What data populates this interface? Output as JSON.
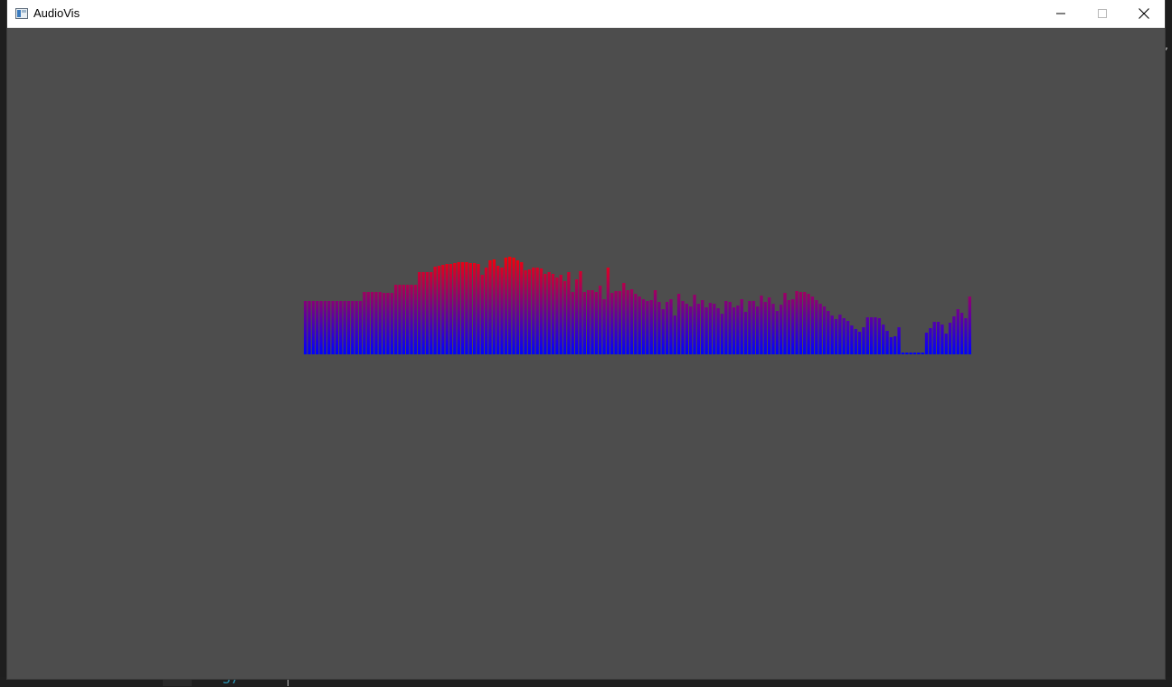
{
  "window": {
    "title": "AudioVis",
    "background_color": "#4d4d4d",
    "titlebar_color": "#ffffff"
  },
  "icons": {
    "app": "app-window-icon",
    "minimize": "minimize-icon",
    "maximize": "maximize-icon",
    "close": "close-icon"
  },
  "spectrum": {
    "bar_count": 185,
    "gradient_top_color": "#ff0000",
    "gradient_bottom_color": "#0000ff",
    "levels": [
      0.59,
      0.59,
      0.59,
      0.59,
      0.59,
      0.59,
      0.59,
      0.59,
      0.59,
      0.59,
      0.59,
      0.59,
      0.59,
      0.59,
      0.59,
      0.69,
      0.69,
      0.69,
      0.69,
      0.69,
      0.68,
      0.68,
      0.68,
      0.77,
      0.77,
      0.77,
      0.77,
      0.77,
      0.77,
      0.91,
      0.91,
      0.91,
      0.91,
      0.97,
      0.98,
      0.99,
      1.0,
      1.0,
      1.01,
      1.02,
      1.02,
      1.02,
      1.01,
      1.01,
      1.0,
      0.88,
      0.96,
      1.04,
      1.05,
      0.98,
      0.96,
      1.07,
      1.08,
      1.07,
      1.04,
      1.02,
      0.93,
      0.94,
      0.96,
      0.96,
      0.95,
      0.89,
      0.91,
      0.89,
      0.85,
      0.88,
      0.81,
      0.91,
      0.69,
      0.83,
      0.92,
      0.69,
      0.71,
      0.71,
      0.69,
      0.76,
      0.61,
      0.96,
      0.68,
      0.7,
      0.7,
      0.79,
      0.71,
      0.72,
      0.67,
      0.64,
      0.61,
      0.59,
      0.6,
      0.71,
      0.58,
      0.5,
      0.58,
      0.61,
      0.43,
      0.67,
      0.59,
      0.56,
      0.53,
      0.66,
      0.56,
      0.6,
      0.52,
      0.57,
      0.56,
      0.51,
      0.45,
      0.59,
      0.58,
      0.52,
      0.54,
      0.61,
      0.47,
      0.59,
      0.59,
      0.53,
      0.65,
      0.58,
      0.63,
      0.56,
      0.48,
      0.55,
      0.68,
      0.6,
      0.61,
      0.7,
      0.69,
      0.69,
      0.67,
      0.64,
      0.6,
      0.56,
      0.53,
      0.48,
      0.43,
      0.39,
      0.44,
      0.4,
      0.37,
      0.32,
      0.28,
      0.25,
      0.3,
      0.41,
      0.41,
      0.41,
      0.4,
      0.33,
      0.26,
      0.19,
      0.2,
      0.3,
      0.02,
      0.02,
      0.02,
      0.02,
      0.02,
      0.02,
      0.24,
      0.29,
      0.36,
      0.36,
      0.33,
      0.23,
      0.35,
      0.42,
      0.5,
      0.46,
      0.4,
      0.64
    ]
  }
}
